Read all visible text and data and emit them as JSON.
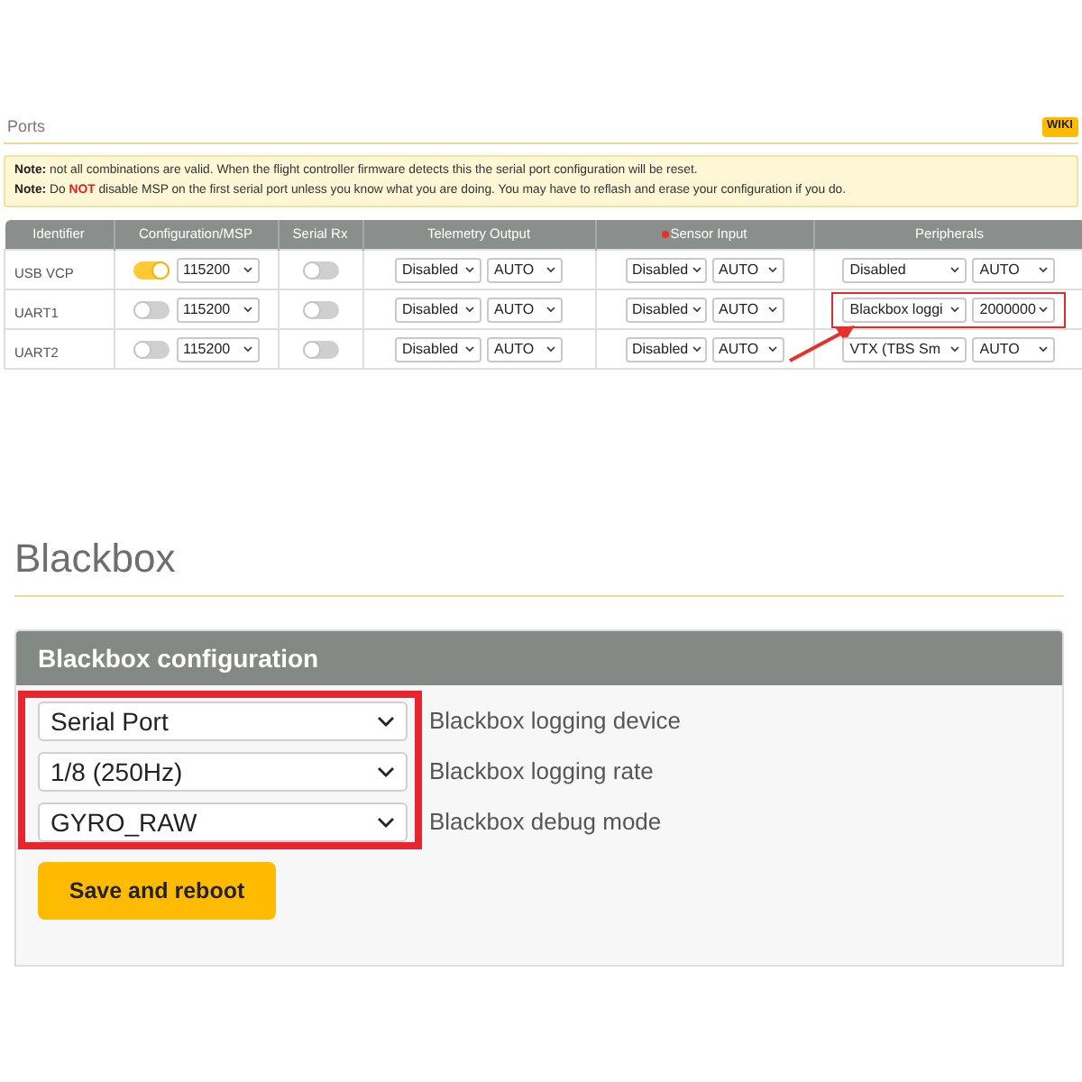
{
  "ports": {
    "title": "Ports",
    "wiki_button": "WIKI",
    "notes": [
      {
        "label": "Note:",
        "text": "not all combinations are valid. When the flight controller firmware detects this the serial port configuration will be reset."
      },
      {
        "label": "Note:",
        "text": "Do **NOT** disable MSP on the first serial port unless you know what you are doing. You may have to reflash and erase your configuration if you do."
      }
    ],
    "table": {
      "columns": [
        {
          "label": "Identifier",
          "marked": false
        },
        {
          "label": "Configuration/MSP",
          "marked": false
        },
        {
          "label": "Serial Rx",
          "marked": false
        },
        {
          "label": "Telemetry Output",
          "marked": false
        },
        {
          "label": "Sensor Input",
          "marked": true
        },
        {
          "label": "Peripherals",
          "marked": false
        }
      ],
      "rows": [
        {
          "identifier": "USB VCP",
          "msp": true,
          "msp_baud": "115200",
          "serial_rx": false,
          "telemetry": "Disabled",
          "telemetry_baud": "AUTO",
          "sensor": "Disabled",
          "sensor_baud": "AUTO",
          "peripheral": "Disabled",
          "peripheral_baud": "AUTO",
          "highlighted": false
        },
        {
          "identifier": "UART1",
          "msp": false,
          "msp_baud": "115200",
          "serial_rx": false,
          "telemetry": "Disabled",
          "telemetry_baud": "AUTO",
          "sensor": "Disabled",
          "sensor_baud": "AUTO",
          "peripheral": "Blackbox loggi",
          "peripheral_baud": "2000000",
          "highlighted": true
        },
        {
          "identifier": "UART2",
          "msp": false,
          "msp_baud": "115200",
          "serial_rx": false,
          "telemetry": "Disabled",
          "telemetry_baud": "AUTO",
          "sensor": "Disabled",
          "sensor_baud": "AUTO",
          "peripheral": "VTX (TBS Sm",
          "peripheral_baud": "AUTO",
          "highlighted": false
        }
      ]
    }
  },
  "blackbox": {
    "title": "Blackbox",
    "panel_title": "Blackbox configuration",
    "highlighted": true,
    "settings": [
      {
        "value": "Serial Port",
        "label": "Blackbox logging device"
      },
      {
        "value": "1/8 (250Hz)",
        "label": "Blackbox logging rate"
      },
      {
        "value": "GYRO_RAW",
        "label": "Blackbox debug mode"
      }
    ],
    "save_button": "Save and reboot"
  }
}
